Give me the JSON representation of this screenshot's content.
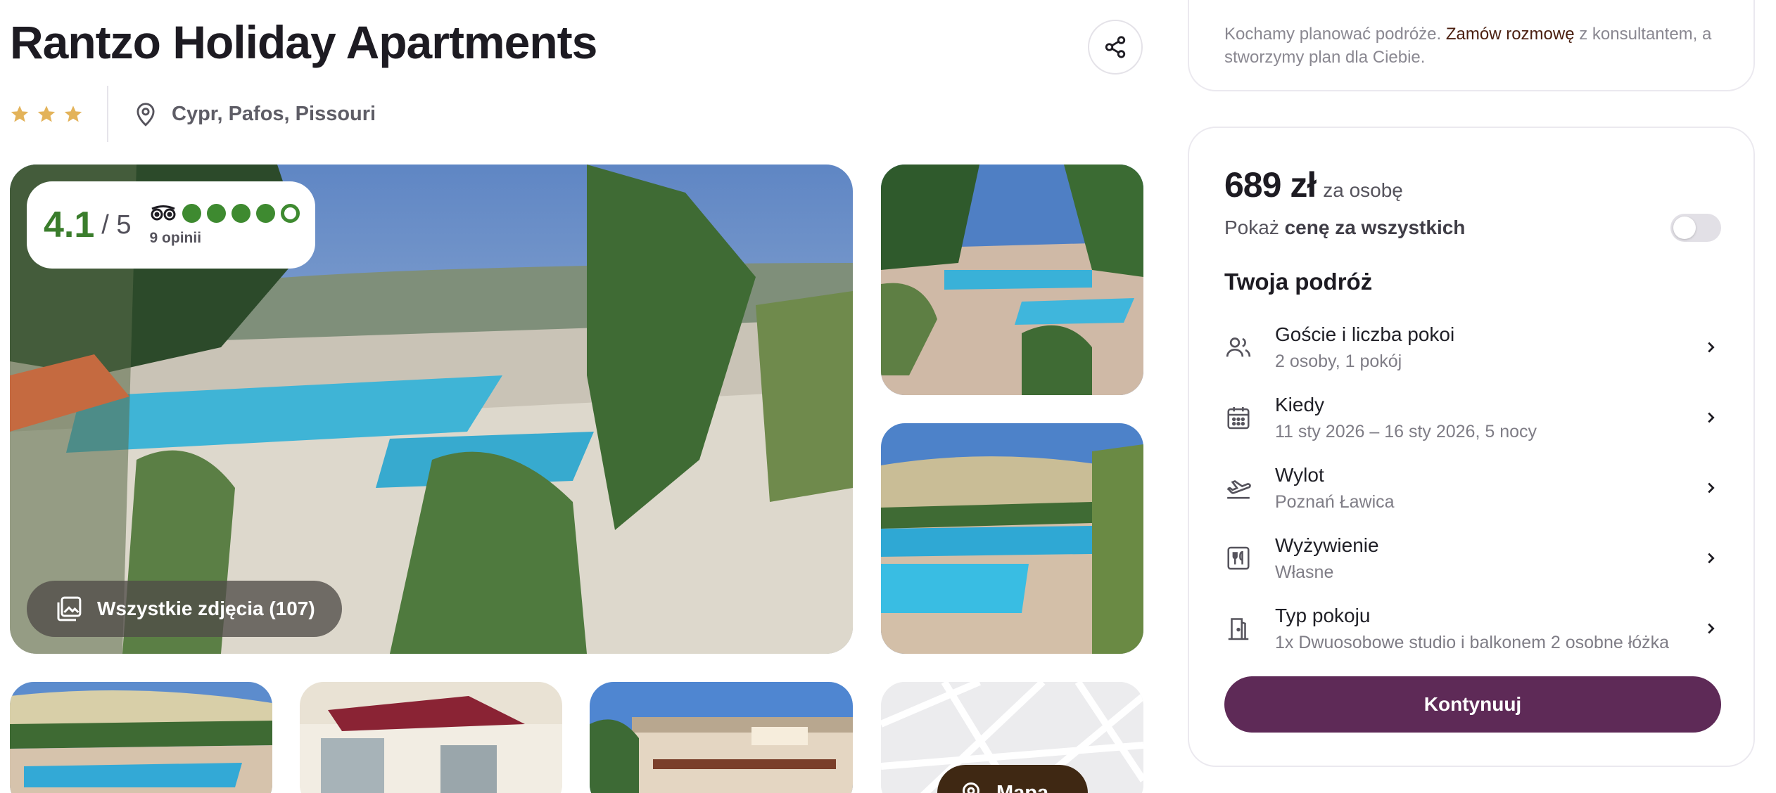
{
  "hotel": {
    "name": "Rantzo Holiday Apartments",
    "stars": 3,
    "location": "Cypr, Pafos, Pissouri"
  },
  "rating": {
    "score": "4.1",
    "out_of": "/ 5",
    "provider_icon": "tripadvisor-owl-icon",
    "bubbles_filled": 4,
    "bubbles_total": 5,
    "reviews": "9 opinii",
    "color": "#3e8a30"
  },
  "gallery": {
    "all_photos_label": "Wszystkie zdjęcia (107)",
    "map_label": "Mapa"
  },
  "consult": {
    "text_before": "Kochamy planować podróże.",
    "link": "Zamów rozmowę",
    "text_after": "z konsultantem, a stworzymy plan dla Ciebie."
  },
  "booking": {
    "price": "689 zł",
    "price_per": "za osobę",
    "toggle_prefix": "Pokaż",
    "toggle_bold": "cenę za wszystkich",
    "toggle_on": false,
    "trip_title": "Twoja podróż",
    "items": [
      {
        "icon": "users-icon",
        "label": "Goście i liczba pokoi",
        "value": "2 osoby, 1 pokój"
      },
      {
        "icon": "calendar-icon",
        "label": "Kiedy",
        "value": "11 sty 2026 – 16 sty 2026, 5 nocy"
      },
      {
        "icon": "plane-departure-icon",
        "label": "Wylot",
        "value": "Poznań Ławica"
      },
      {
        "icon": "food-icon",
        "label": "Wyżywienie",
        "value": "Własne"
      },
      {
        "icon": "room-door-icon",
        "label": "Typ pokoju",
        "value": "1x Dwuosobowe studio i balkonem 2 osobne łóżka"
      }
    ],
    "continue_label": "Kontynuuj",
    "accent": "#5e2a57"
  },
  "colors": {
    "star": "#e3b35a",
    "map_button": "#3f2813",
    "consult_link": "#4a1f10"
  }
}
